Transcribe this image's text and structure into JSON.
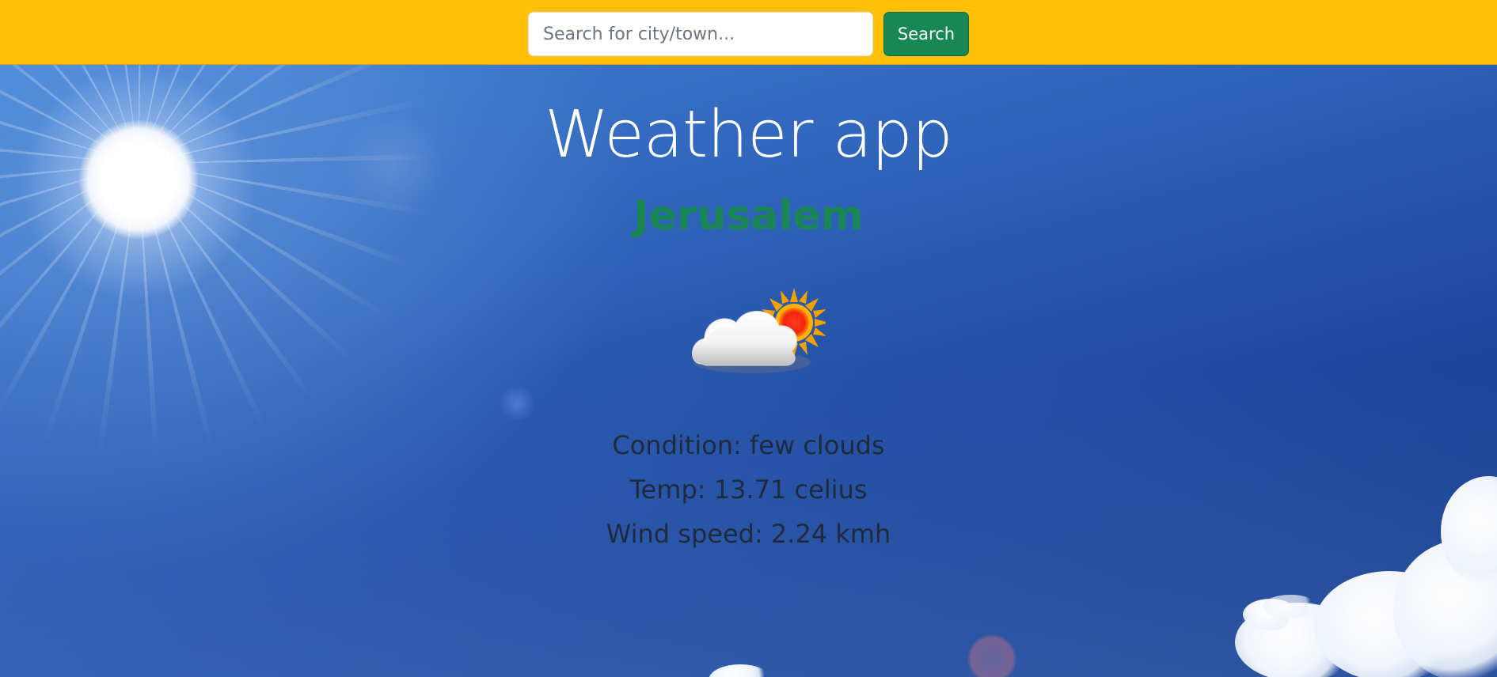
{
  "search": {
    "placeholder": "Search for city/town...",
    "value": "",
    "button_label": "Search"
  },
  "header": {
    "title": "Weather app"
  },
  "weather": {
    "city": "Jerusalem",
    "icon": "partly-cloudy-icon",
    "condition": "Condition: few clouds",
    "temp": "Temp: 13.71 celius",
    "wind": "Wind speed: 2.24 kmh"
  },
  "colors": {
    "navbar": "#ffc107",
    "search_button": "#198754",
    "city_text": "#198754",
    "title_text": "#ffffff",
    "info_text": "#1f2b3a"
  }
}
